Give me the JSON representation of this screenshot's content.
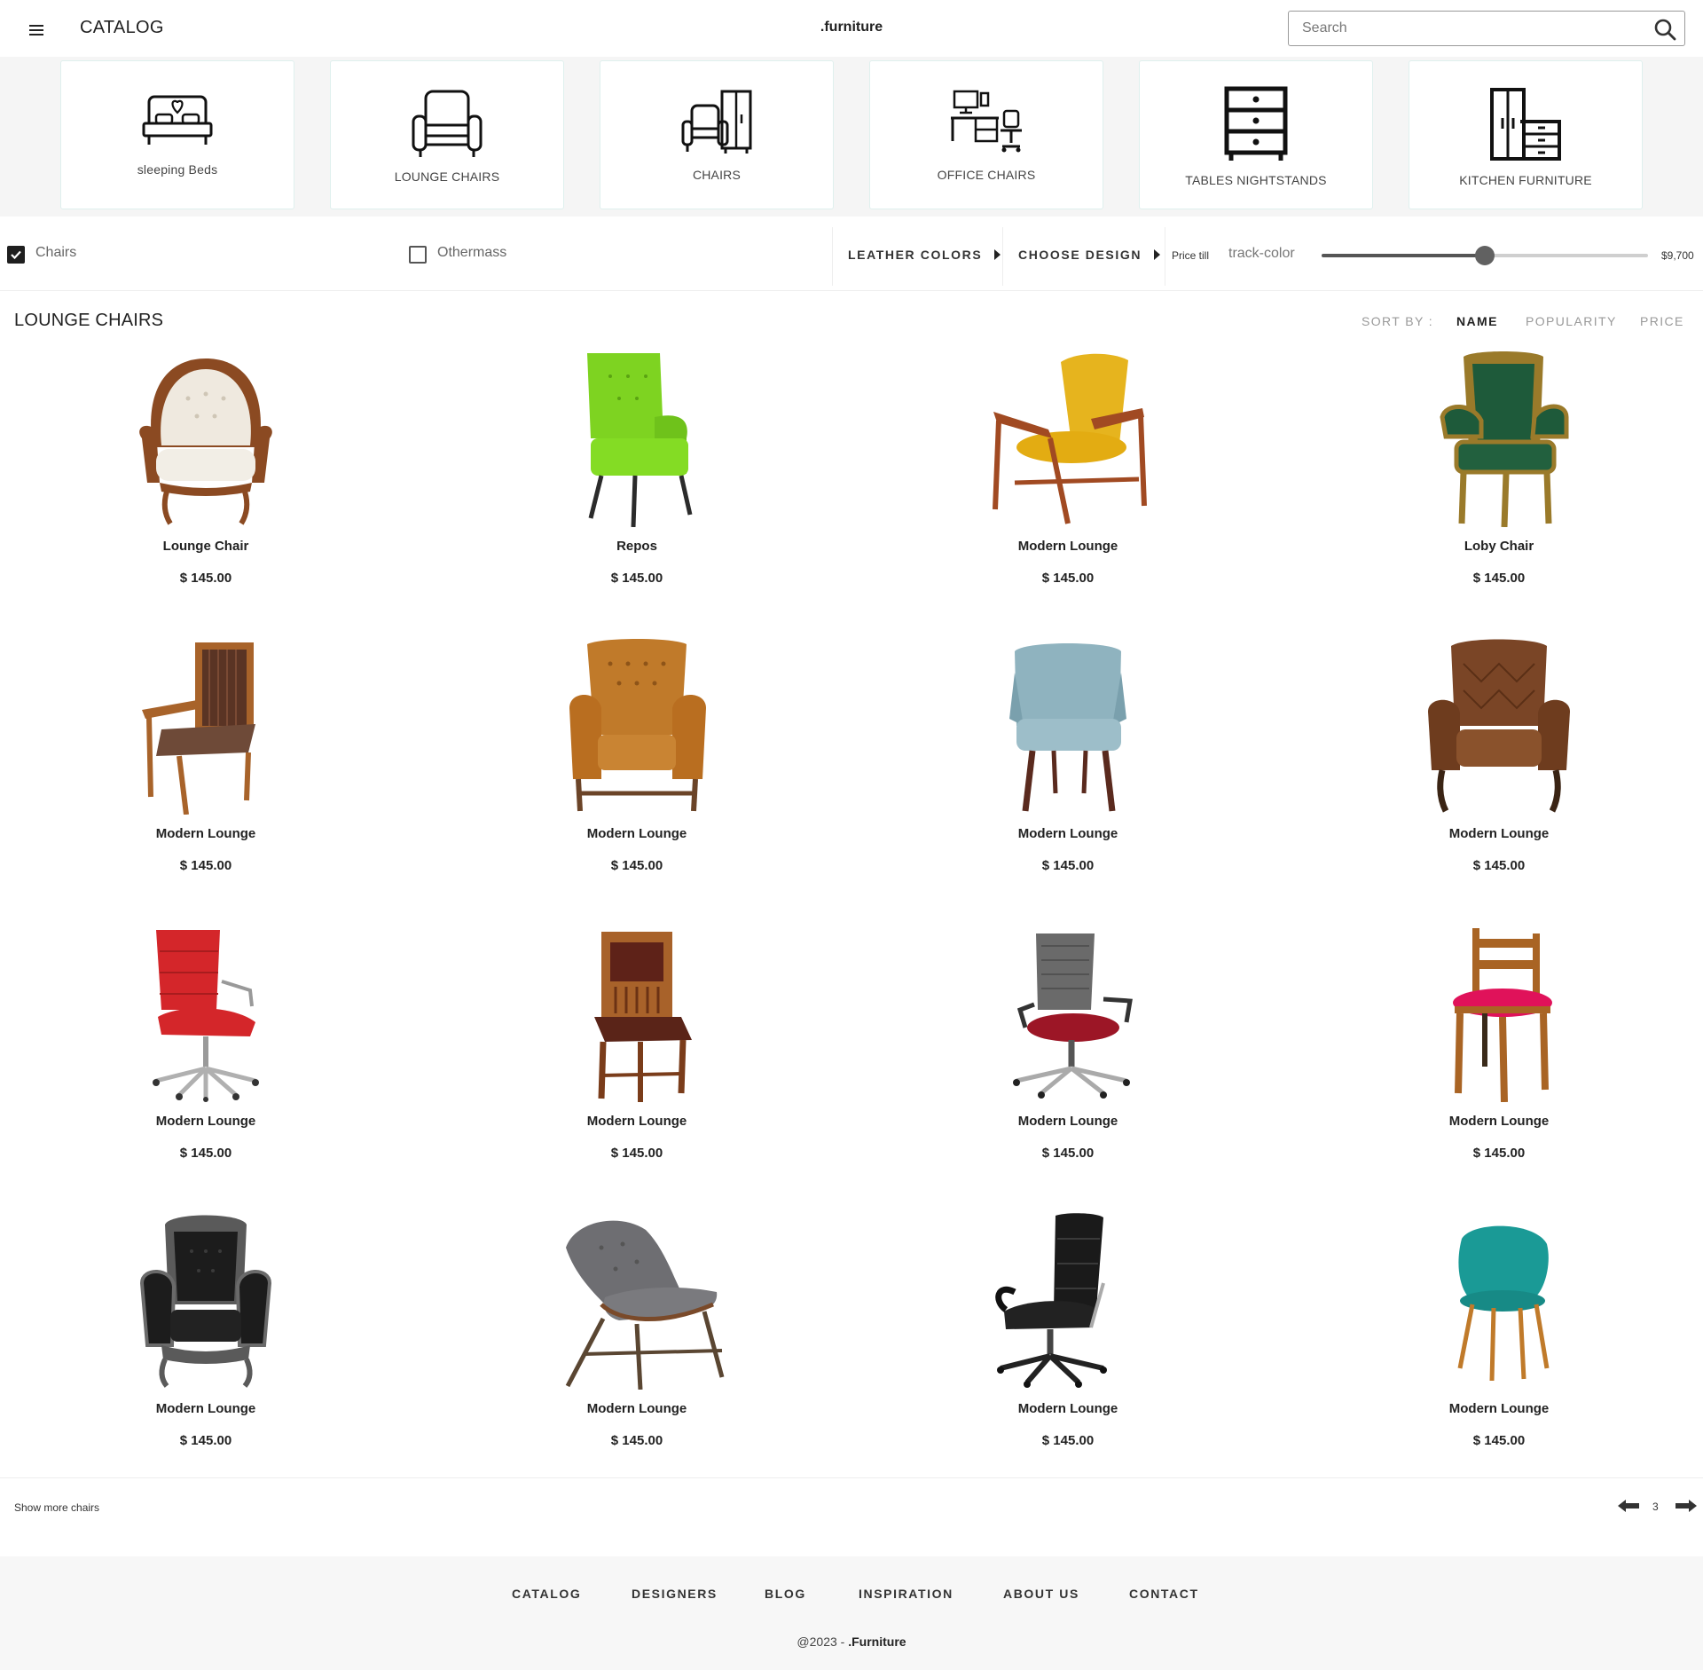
{
  "header": {
    "menu_icon": "hamburger-menu-icon",
    "title": "CATALOG",
    "brand": ".furniture",
    "search_placeholder": "Search",
    "search_icon": "search-icon"
  },
  "categories": [
    {
      "label": "sleeping Beds",
      "icon": "bed-icon"
    },
    {
      "label": "LOUNGE CHAIRS",
      "icon": "armchair-icon"
    },
    {
      "label": "CHAIRS",
      "icon": "chair-cabinet-icon"
    },
    {
      "label": "OFFICE CHAIRS",
      "icon": "office-desk-icon"
    },
    {
      "label": "TABLES NIGHTSTANDS",
      "icon": "drawers-icon"
    },
    {
      "label": "KITCHEN FURNITURE",
      "icon": "kitchen-cabinet-icon"
    }
  ],
  "filters": {
    "checkbox_1": {
      "label": "Chairs",
      "checked": true
    },
    "checkbox_2": {
      "label": "Othermass",
      "checked": false
    },
    "leather_colors": "LEATHER COLORS",
    "choose_design": "CHOOSE DESIGN",
    "price_label": "Price till",
    "track_label": "track-color",
    "price_max": "$9,700",
    "slider_level": 0.5
  },
  "section": {
    "title": "LOUNGE CHAIRS",
    "sort_label": "SORT BY :",
    "sort_options": [
      {
        "label": "NAME",
        "active": true
      },
      {
        "label": "POPULARITY",
        "active": false
      },
      {
        "label": "PRICE",
        "active": false
      }
    ]
  },
  "products": [
    {
      "name": "Lounge Chair",
      "price": "$ 145.00",
      "image": "cream-tufted-armchair"
    },
    {
      "name": "Repos",
      "price": "$ 145.00",
      "image": "green-wingback-chair"
    },
    {
      "name": "Modern Lounge",
      "price": "$ 145.00",
      "image": "yellow-wood-lounge-chair"
    },
    {
      "name": "Loby Chair",
      "price": "$ 145.00",
      "image": "green-velvet-baroque-chair"
    },
    {
      "name": "Modern Lounge",
      "price": "$ 145.00",
      "image": "striped-wood-armchair"
    },
    {
      "name": "Modern Lounge",
      "price": "$ 145.00",
      "image": "tan-leather-wingback"
    },
    {
      "name": "Modern Lounge",
      "price": "$ 145.00",
      "image": "light-blue-dining-chair"
    },
    {
      "name": "Modern Lounge",
      "price": "$ 145.00",
      "image": "brown-chesterfield-armchair"
    },
    {
      "name": "Modern Lounge",
      "price": "$ 145.00",
      "image": "red-leather-office-chair"
    },
    {
      "name": "Modern Lounge",
      "price": "$ 145.00",
      "image": "carved-wood-chair"
    },
    {
      "name": "Modern Lounge",
      "price": "$ 145.00",
      "image": "mesh-red-office-chair"
    },
    {
      "name": "Modern Lounge",
      "price": "$ 145.00",
      "image": "wood-pink-seat-chair"
    },
    {
      "name": "Modern Lounge",
      "price": "$ 145.00",
      "image": "black-baroque-armchair"
    },
    {
      "name": "Modern Lounge",
      "price": "$ 145.00",
      "image": "grey-tufted-lounge"
    },
    {
      "name": "Modern Lounge",
      "price": "$ 145.00",
      "image": "black-executive-chair"
    },
    {
      "name": "Modern Lounge",
      "price": "$ 145.00",
      "image": "teal-shell-chair"
    }
  ],
  "pagination": {
    "show_more": "Show more chairs",
    "page": "3",
    "prev_icon": "arrow-left-icon",
    "next_icon": "arrow-right-icon"
  },
  "footer": {
    "nav": [
      "CATALOG",
      "DESIGNERS",
      "BLOG",
      "INSPIRATION",
      "ABOUT US",
      "CONTACT"
    ],
    "copyright_prefix": "@2023 - ",
    "copyright_brand": ".Furniture"
  },
  "colors": {
    "strip_bg": "#f5f5f5",
    "card_border": "#dff0ee",
    "footer_bg": "#f7f7f7",
    "text_dark": "#222222",
    "text_muted": "#999999"
  }
}
